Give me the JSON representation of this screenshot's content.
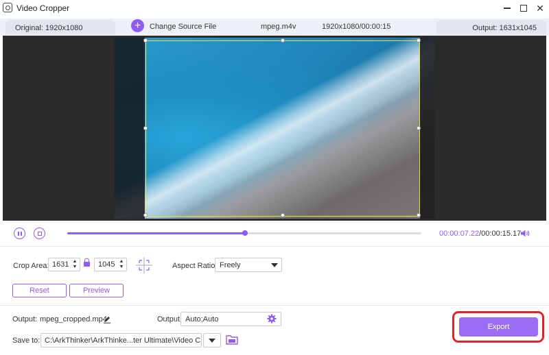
{
  "window": {
    "title": "Video Cropper"
  },
  "infobar": {
    "original": "Original: 1920x1080",
    "change_source": "Change Source File",
    "filename": "mpeg.m4v",
    "file_info": "1920x1080/00:00:15",
    "output": "Output: 1631x1045"
  },
  "playback": {
    "current_time": "00:00:07.22",
    "total_time": "/00:00:15.17",
    "progress": 0.502
  },
  "crop": {
    "area_label": "Crop Area:",
    "width": "1631",
    "height": "1045",
    "aspect_label": "Aspect Ratio:",
    "aspect_value": "Freely",
    "reset_label": "Reset",
    "preview_label": "Preview"
  },
  "output": {
    "name_label": "Output:",
    "filename": "mpeg_cropped.mp4",
    "settings_label": "Output:",
    "settings_value": "Auto;Auto",
    "save_label": "Save to:",
    "save_path": "C:\\ArkThinker\\ArkThinke...ter Ultimate\\Video Crop",
    "export_label": "Export"
  },
  "colors": {
    "accent": "#8e5cf2",
    "highlight": "#e0242b",
    "crop_border": "#e7e24a"
  }
}
